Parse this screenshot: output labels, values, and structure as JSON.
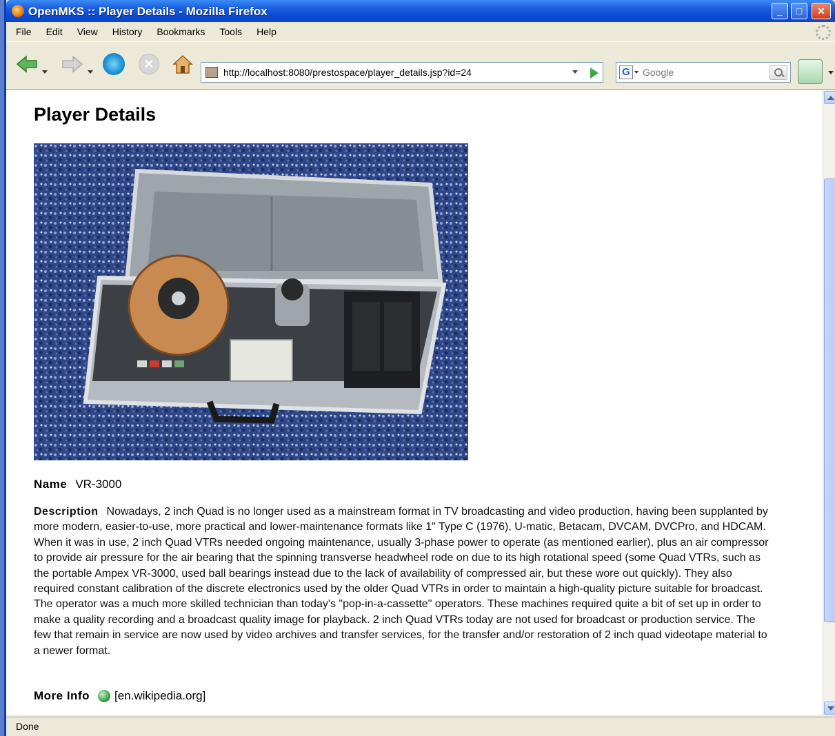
{
  "window": {
    "title": "OpenMKS :: Player Details - Mozilla Firefox",
    "min_label": "_",
    "max_label": "□",
    "close_label": "✕"
  },
  "menu": {
    "items": [
      "File",
      "Edit",
      "View",
      "History",
      "Bookmarks",
      "Tools",
      "Help"
    ]
  },
  "toolbar": {
    "url": "http://localhost:8080/prestospace/player_details.jsp?id=24",
    "search_placeholder": "Google",
    "search_engine_letter": "G",
    "stop_label": "✕"
  },
  "page": {
    "title": "Player Details",
    "name_label": "Name",
    "name_value": "VR-3000",
    "description_label": "Description",
    "description_value": "Nowadays, 2 inch Quad is no longer used as a mainstream format in TV broadcasting and video production, having been supplanted by more modern, easier-to-use, more practical and lower-maintenance formats like 1\" Type C (1976), U-matic, Betacam, DVCAM, DVCPro, and HDCAM. When it was in use, 2 inch Quad VTRs needed ongoing maintenance, usually 3-phase power to operate (as mentioned earlier), plus an air compressor to provide air pressure for the air bearing that the spinning transverse headwheel rode on due to its high rotational speed (some Quad VTRs, such as the portable Ampex VR-3000, used ball bearings instead due to the lack of availability of compressed air, but these wore out quickly). They also required constant calibration of the discrete electronics used by the older Quad VTRs in order to maintain a high-quality picture suitable for broadcast. The operator was a much more skilled technician than today's \"pop-in-a-cassette\" operators. These machines required quite a bit of set up in order to make a quality recording and a broadcast quality image for playback. 2 inch Quad VTRs today are not used for broadcast or production service. The few that remain in service are now used by video archives and transfer services, for the transfer and/or restoration of 2 inch quad videotape material to a newer format.",
    "more_info_label": "More Info",
    "more_info_link": "[en.wikipedia.org]"
  },
  "status": {
    "text": "Done"
  },
  "colors": {
    "titlebar": "#0a4bd6",
    "chrome": "#ece9d8"
  }
}
